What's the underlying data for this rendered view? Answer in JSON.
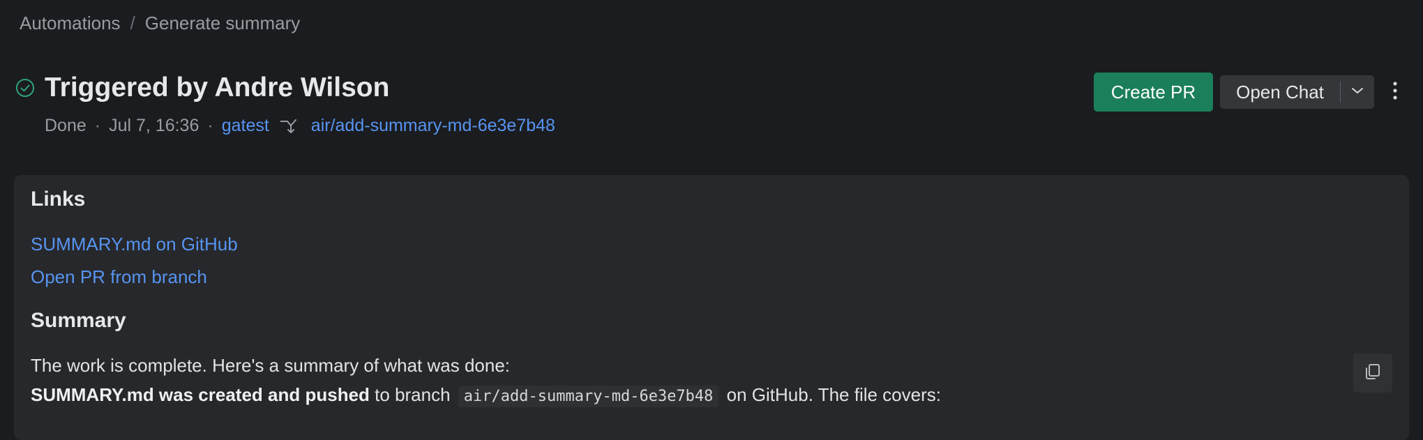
{
  "breadcrumb": {
    "items": [
      "Automations",
      "Generate summary"
    ],
    "separator": "/"
  },
  "header": {
    "status_icon": "check-circle-icon",
    "title": "Triggered by Andre Wilson",
    "status": "Done",
    "timestamp": "Jul 7, 16:36",
    "repo": "gatest",
    "branch": "air/add-summary-md-6e3e7b48",
    "meta_separator": "·"
  },
  "actions": {
    "create_pr": "Create PR",
    "open_chat": "Open Chat",
    "caret_icon": "chevron-down-icon",
    "more_icon": "more-vertical-icon"
  },
  "links_section": {
    "title": "Links",
    "items": [
      "SUMMARY.md on GitHub",
      "Open PR from branch"
    ]
  },
  "summary_section": {
    "title": "Summary",
    "intro": "The work is complete. Here's a summary of what was done:",
    "line2_bold": "SUMMARY.md was created and pushed",
    "line2_pre": "to branch",
    "line2_code": "air/add-summary-md-6e3e7b48",
    "line2_post": "on GitHub. The file covers:",
    "copy_icon": "copy-icon"
  },
  "colors": {
    "background": "#1b1c1f",
    "panel": "#27282b",
    "accent_green": "#1a7f5a",
    "link_blue": "#5794f2",
    "success_green": "#2fa37a"
  }
}
